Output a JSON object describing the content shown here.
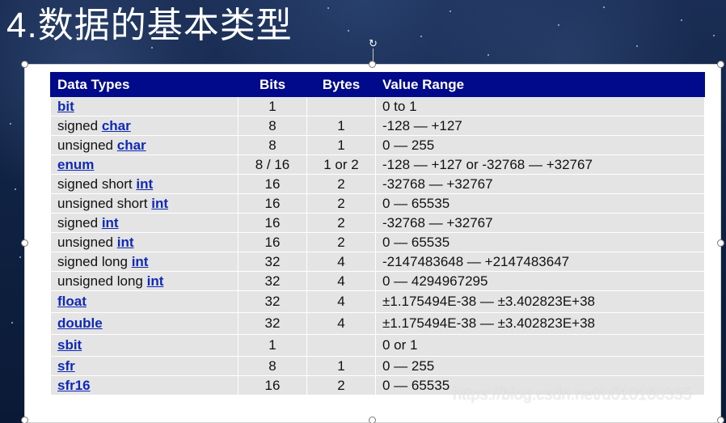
{
  "slide": {
    "title": "4.数据的基本类型"
  },
  "table": {
    "headers": {
      "type": "Data Types",
      "bits": "Bits",
      "bytes": "Bytes",
      "range": "Value Range"
    },
    "rows": [
      {
        "prefix": "",
        "keyword": "bit",
        "bits": "1",
        "bytes": "",
        "range": "0 to 1"
      },
      {
        "prefix": "signed ",
        "keyword": "char",
        "bits": "8",
        "bytes": "1",
        "range": "-128 — +127"
      },
      {
        "prefix": "unsigned ",
        "keyword": "char",
        "bits": "8",
        "bytes": "1",
        "range": "0 — 255"
      },
      {
        "prefix": "",
        "keyword": "enum",
        "bits": "8 / 16",
        "bytes": "1 or 2",
        "range": "-128 — +127 or -32768 — +32767"
      },
      {
        "prefix": "signed short ",
        "keyword": "int",
        "bits": "16",
        "bytes": "2",
        "range": "-32768 — +32767"
      },
      {
        "prefix": "unsigned short ",
        "keyword": "int",
        "bits": "16",
        "bytes": "2",
        "range": "0 — 65535"
      },
      {
        "prefix": "signed ",
        "keyword": "int",
        "bits": "16",
        "bytes": "2",
        "range": "-32768 — +32767"
      },
      {
        "prefix": "unsigned ",
        "keyword": "int",
        "bits": "16",
        "bytes": "2",
        "range": "0 — 65535"
      },
      {
        "prefix": "signed long ",
        "keyword": "int",
        "bits": "32",
        "bytes": "4",
        "range": "-2147483648 — +2147483647"
      },
      {
        "prefix": "unsigned long ",
        "keyword": "int",
        "bits": "32",
        "bytes": "4",
        "range": "0 — 4294967295"
      },
      {
        "prefix": "",
        "keyword": "float",
        "bits": "32",
        "bytes": "4",
        "range": "±1.175494E-38 — ±3.402823E+38"
      },
      {
        "prefix": "",
        "keyword": "double",
        "bits": "32",
        "bytes": "4",
        "range": "±1.175494E-38 — ±3.402823E+38"
      },
      {
        "prefix": "",
        "keyword": "sbit",
        "bits": "1",
        "bytes": "",
        "range": "0 or 1"
      },
      {
        "prefix": "",
        "keyword": "sfr",
        "bits": "8",
        "bytes": "1",
        "range": "0 — 255"
      },
      {
        "prefix": "",
        "keyword": "sfr16",
        "bits": "16",
        "bytes": "2",
        "range": "0 — 65535"
      }
    ]
  },
  "watermark": "https://blog.csdn.net/u010160335",
  "colors": {
    "header_bg": "#000a8a",
    "row_bg": "#e4e4e4",
    "link": "#0f29b6"
  }
}
